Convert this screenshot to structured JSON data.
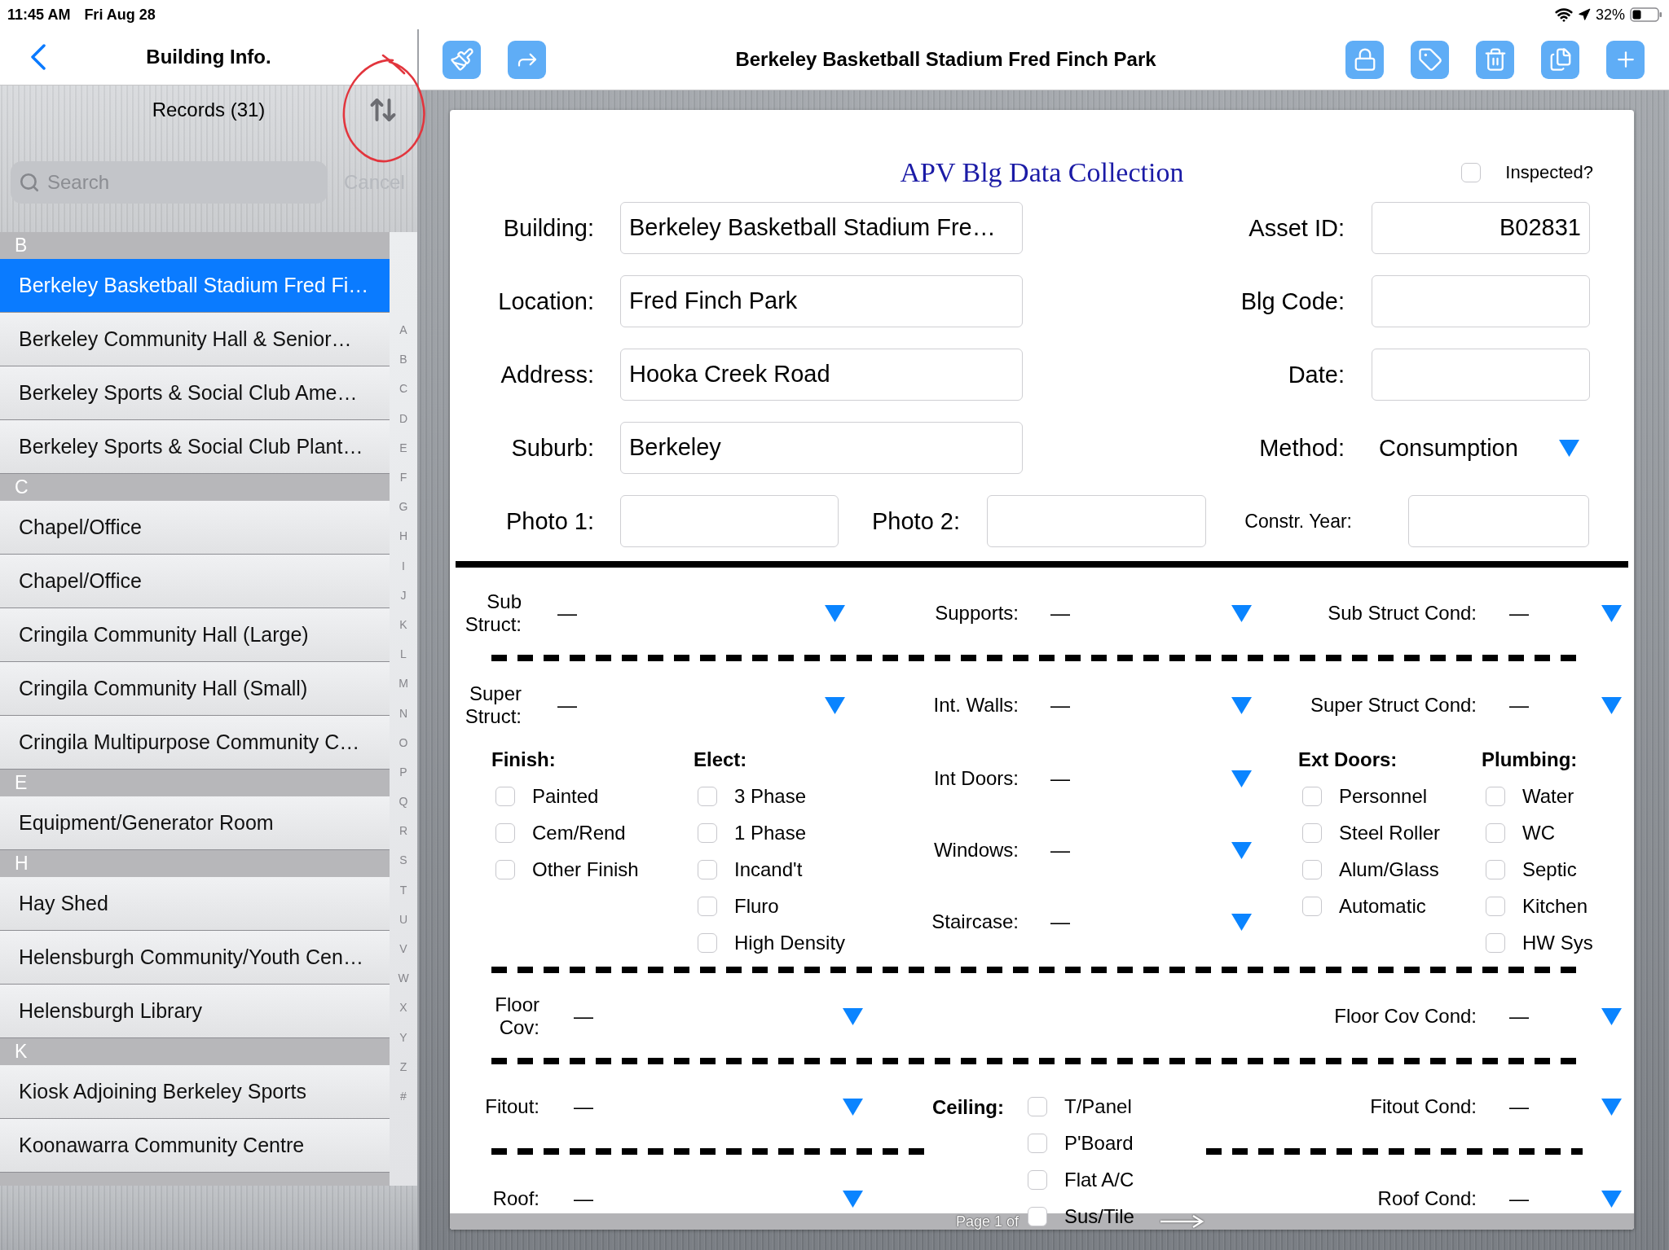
{
  "status_bar": {
    "time": "11:45 AM",
    "date": "Fri Aug 28",
    "battery": "32%"
  },
  "sidebar": {
    "title": "Building Info.",
    "list_title": "Records (31)",
    "search": {
      "placeholder": "Search"
    },
    "cancel": {
      "label": "Cancel",
      "disabled": true
    },
    "sections": [
      {
        "letter": "B",
        "items": [
          {
            "label": "Berkeley Basketball Stadium Fred Fi…",
            "selected": true
          },
          {
            "label": "Berkeley Community Hall & Senior…",
            "selected": false
          },
          {
            "label": "Berkeley Sports & Social Club Ame…",
            "selected": false
          },
          {
            "label": "Berkeley Sports & Social Club Plant…",
            "selected": false
          }
        ]
      },
      {
        "letter": "C",
        "items": [
          {
            "label": "Chapel/Office",
            "selected": false
          },
          {
            "label": "Chapel/Office",
            "selected": false
          },
          {
            "label": "Cringila Community Hall (Large)",
            "selected": false
          },
          {
            "label": "Cringila Community Hall (Small)",
            "selected": false
          },
          {
            "label": "Cringila Multipurpose Community C…",
            "selected": false
          }
        ]
      },
      {
        "letter": "E",
        "items": [
          {
            "label": "Equipment/Generator Room",
            "selected": false
          }
        ]
      },
      {
        "letter": "H",
        "items": [
          {
            "label": "Hay Shed",
            "selected": false
          },
          {
            "label": "Helensburgh Community/Youth Cen…",
            "selected": false
          },
          {
            "label": "Helensburgh Library",
            "selected": false
          }
        ]
      },
      {
        "letter": "K",
        "items": [
          {
            "label": "Kiosk Adjoining Berkeley Sports",
            "selected": false
          },
          {
            "label": "Koonawarra Community Centre",
            "selected": false
          }
        ]
      }
    ],
    "index": [
      "A",
      "B",
      "C",
      "D",
      "E",
      "F",
      "G",
      "H",
      "I",
      "J",
      "K",
      "L",
      "M",
      "N",
      "O",
      "P",
      "Q",
      "R",
      "S",
      "T",
      "U",
      "V",
      "W",
      "X",
      "Y",
      "Z",
      "#"
    ]
  },
  "toolbar": {
    "title": "Berkeley Basketball Stadium Fred Finch Park"
  },
  "form": {
    "title": "APV Blg Data Collection",
    "inspected": {
      "label": "Inspected?",
      "checked": false
    },
    "field_rows": [
      [
        {
          "kind": "text",
          "label": "Building:",
          "value": "Berkeley Basketball Stadium Fre…"
        },
        {
          "kind": "text",
          "label": "Asset ID:",
          "value": "B02831"
        }
      ],
      [
        {
          "kind": "text",
          "label": "Location:",
          "value": "Fred Finch Park"
        },
        {
          "kind": "text",
          "label": "Blg Code:"
        }
      ],
      [
        {
          "kind": "text",
          "label": "Address:",
          "value": "Hooka Creek Road"
        },
        {
          "kind": "text",
          "label": "Date:"
        }
      ],
      [
        {
          "kind": "text",
          "label": "Suburb:",
          "value": "Berkeley"
        },
        {
          "kind": "dropdown",
          "label": "Method:",
          "value": "Consumption"
        }
      ]
    ],
    "photo_row": [
      {
        "label": "Photo 1:"
      },
      {
        "label": "Photo 2:"
      },
      {
        "label": "Constr. Year:"
      }
    ],
    "sub_structure": [
      {
        "label": "Sub Struct:",
        "value": "—"
      },
      {
        "label": "Supports:",
        "value": "—"
      },
      {
        "label": "Sub Struct Cond:",
        "value": "—"
      }
    ],
    "super_structure": [
      {
        "label": "Super Struct:",
        "value": "—"
      },
      {
        "label": "Int. Walls:",
        "value": "—"
      },
      {
        "label": "Super Struct Cond:",
        "value": "—"
      }
    ],
    "finish": {
      "title": "Finish:",
      "options": [
        {
          "label": "Painted",
          "checked": false
        },
        {
          "label": "Cem/Rend",
          "checked": false
        },
        {
          "label": "Other Finish",
          "checked": false
        }
      ]
    },
    "electrical": {
      "title": "Elect:",
      "options": [
        {
          "label": "3 Phase",
          "checked": false
        },
        {
          "label": "1 Phase",
          "checked": false
        },
        {
          "label": "Incand't",
          "checked": false
        },
        {
          "label": "Fluro",
          "checked": false
        },
        {
          "label": "High Density",
          "checked": false
        }
      ]
    },
    "interior": [
      {
        "label": "Int Doors:",
        "value": "—"
      },
      {
        "label": "Windows:",
        "value": "—"
      },
      {
        "label": "Staircase:",
        "value": "—"
      }
    ],
    "ext_doors": {
      "title": "Ext Doors:",
      "options": [
        {
          "label": "Personnel",
          "checked": false
        },
        {
          "label": "Steel Roller",
          "checked": false
        },
        {
          "label": "Alum/Glass",
          "checked": false
        },
        {
          "label": "Automatic",
          "checked": false
        }
      ]
    },
    "plumbing": {
      "title": "Plumbing:",
      "options": [
        {
          "label": "Water",
          "checked": false
        },
        {
          "label": "WC",
          "checked": false
        },
        {
          "label": "Septic",
          "checked": false
        },
        {
          "label": "Kitchen",
          "checked": false
        },
        {
          "label": "HW Sys",
          "checked": false
        }
      ]
    },
    "floor": [
      {
        "label": "Floor Cov:",
        "value": "—"
      },
      {
        "label": "Floor Cov Cond:",
        "value": "—"
      }
    ],
    "fitout": [
      {
        "label": "Fitout:",
        "value": "—"
      },
      {
        "label": "Fitout Cond:",
        "value": "—"
      }
    ],
    "ceiling": {
      "title": "Ceiling:",
      "options": [
        {
          "label": "T/Panel",
          "checked": false
        },
        {
          "label": "P'Board",
          "checked": false
        },
        {
          "label": "Flat A/C",
          "checked": false
        },
        {
          "label": "Sus/Tile",
          "checked": false
        }
      ]
    },
    "roof": [
      {
        "label": "Roof:",
        "value": "—"
      },
      {
        "label": "Roof Cond:",
        "value": "—"
      }
    ],
    "pager": {
      "label": "Page 1 of"
    }
  }
}
